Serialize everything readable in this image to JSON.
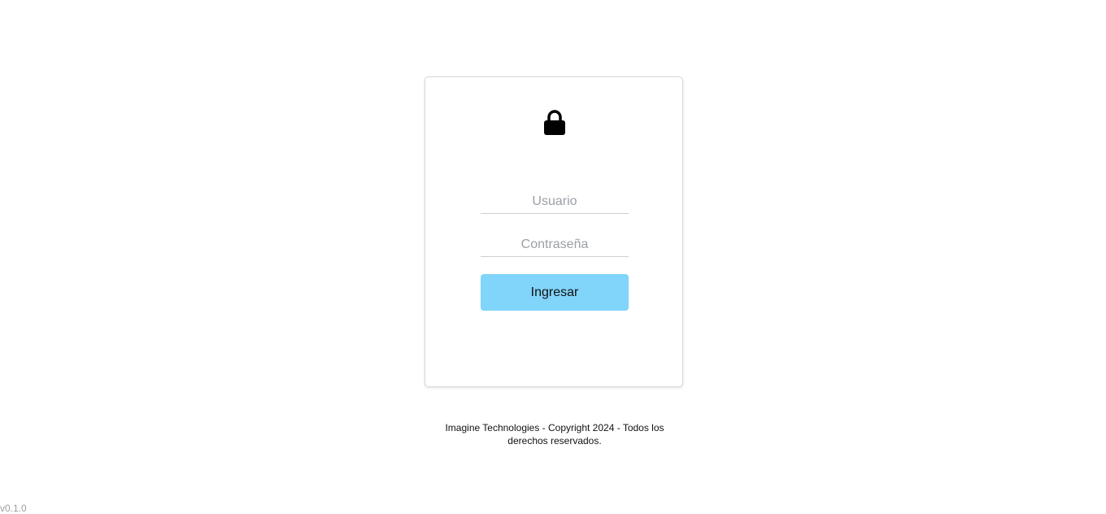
{
  "login": {
    "icon": "lock-icon",
    "username_placeholder": "Usuario",
    "username_value": "",
    "password_placeholder": "Contraseña",
    "password_value": "",
    "submit_label": "Ingresar",
    "button_color": "#81d4fa"
  },
  "footer": {
    "text": "Imagine Technologies - Copyright 2024 - Todos los derechos reservados."
  },
  "version": "v0.1.0"
}
